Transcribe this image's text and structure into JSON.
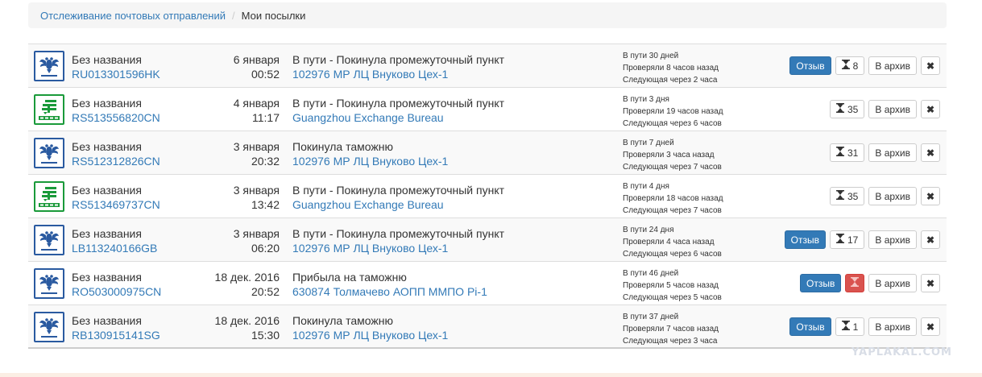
{
  "breadcrumb": {
    "link": "Отслеживание почтовых отправлений",
    "separator": "/",
    "current": "Мои посылки"
  },
  "rows": [
    {
      "carrier": "russian-post",
      "name": "Без названия",
      "tracking": "RU013301596HK",
      "date": "6 января",
      "time": "00:52",
      "status": "В пути - Покинула промежуточный пункт",
      "location": "102976 МР ЛЦ Внуково Цех-1",
      "transit": "В пути 30 дней",
      "checked": "Проверяли 8 часов назад",
      "next": "Следующая через 2 часа",
      "review": "Отзыв",
      "timer": "8",
      "timer_alert": false,
      "archive": "В архив"
    },
    {
      "carrier": "china-post",
      "name": "Без названия",
      "tracking": "RS513556820CN",
      "date": "4 января",
      "time": "11:17",
      "status": "В пути - Покинула промежуточный пункт",
      "location": "Guangzhou Exchange Bureau",
      "transit": "В пути 3 дня",
      "checked": "Проверяли 19 часов назад",
      "next": "Следующая через 6 часов",
      "review": "",
      "timer": "35",
      "timer_alert": false,
      "archive": "В архив"
    },
    {
      "carrier": "russian-post",
      "name": "Без названия",
      "tracking": "RS512312826CN",
      "date": "3 января",
      "time": "20:32",
      "status": "Покинула таможню",
      "location": "102976 МР ЛЦ Внуково Цех-1",
      "transit": "В пути 7 дней",
      "checked": "Проверяли 3 часа назад",
      "next": "Следующая через 7 часов",
      "review": "",
      "timer": "31",
      "timer_alert": false,
      "archive": "В архив"
    },
    {
      "carrier": "china-post",
      "name": "Без названия",
      "tracking": "RS513469737CN",
      "date": "3 января",
      "time": "13:42",
      "status": "В пути - Покинула промежуточный пункт",
      "location": "Guangzhou Exchange Bureau",
      "transit": "В пути 4 дня",
      "checked": "Проверяли 18 часов назад",
      "next": "Следующая через 7 часов",
      "review": "",
      "timer": "35",
      "timer_alert": false,
      "archive": "В архив"
    },
    {
      "carrier": "russian-post",
      "name": "Без названия",
      "tracking": "LB113240166GB",
      "date": "3 января",
      "time": "06:20",
      "status": "В пути - Покинула промежуточный пункт",
      "location": "102976 МР ЛЦ Внуково Цех-1",
      "transit": "В пути 24 дня",
      "checked": "Проверяли 4 часа назад",
      "next": "Следующая через 6 часов",
      "review": "Отзыв",
      "timer": "17",
      "timer_alert": false,
      "archive": "В архив"
    },
    {
      "carrier": "russian-post",
      "name": "Без названия",
      "tracking": "RO503000975CN",
      "date": "18 дек. 2016",
      "time": "20:52",
      "status": "Прибыла на таможню",
      "location": "630874 Толмачево АОПП ММПО Pi-1",
      "transit": "В пути 46 дней",
      "checked": "Проверяли 5 часов назад",
      "next": "Следующая через 5 часов",
      "review": "Отзыв",
      "timer": "",
      "timer_alert": true,
      "archive": "В архив"
    },
    {
      "carrier": "russian-post",
      "name": "Без названия",
      "tracking": "RB130915141SG",
      "date": "18 дек. 2016",
      "time": "15:30",
      "status": "Покинула таможню",
      "location": "102976 МР ЛЦ Внуково Цех-1",
      "transit": "В пути 37 дней",
      "checked": "Проверяли 7 часов назад",
      "next": "Следующая через 3 часа",
      "review": "Отзыв",
      "timer": "1",
      "timer_alert": false,
      "archive": "В архив"
    }
  ],
  "icons": {
    "hourglass": "hourglass-icon",
    "close": "close-icon"
  },
  "colors": {
    "link": "#337ab7",
    "primary": "#337ab7",
    "danger": "#d9534f",
    "russian_post": "#2a5aa0",
    "china_post": "#1a9a3a"
  },
  "watermark": "YAPLAKAL.COM"
}
